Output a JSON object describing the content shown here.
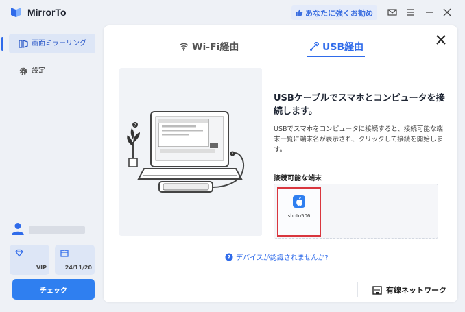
{
  "app": {
    "title": "MirrorTo"
  },
  "header": {
    "recommend_label": "あなたに強くお勧め"
  },
  "sidebar": {
    "items": [
      {
        "label": "画面ミラーリング",
        "icon": "mirror-screen-icon",
        "active": true
      },
      {
        "label": "設定",
        "icon": "gear-icon",
        "active": false
      }
    ],
    "membership": {
      "plan": "VIP",
      "expiry": "24/11/20"
    },
    "check_label": "チェック"
  },
  "main": {
    "tabs": [
      {
        "label": "Wi-Fi経由",
        "icon": "wifi-icon",
        "active": false
      },
      {
        "label": "USB経由",
        "icon": "usb-icon",
        "active": true
      }
    ],
    "heading": "USBケーブルでスマホとコンピュータを接続します。",
    "description": "USBでスマホをコンピュータに接続すると、接続可能な端末一覧に端末名が表示され、クリックして接続を開始します。",
    "devices_label": "接続可能な端末",
    "devices": [
      {
        "name": "shoto506",
        "icon": "apple-icon"
      }
    ],
    "help_link": "デバイスが認識されませんか?",
    "network_label": "有線ネットワーク"
  },
  "colors": {
    "accent": "#2f6bea",
    "highlight_border": "#d9363e",
    "button": "#2f7ff0"
  }
}
